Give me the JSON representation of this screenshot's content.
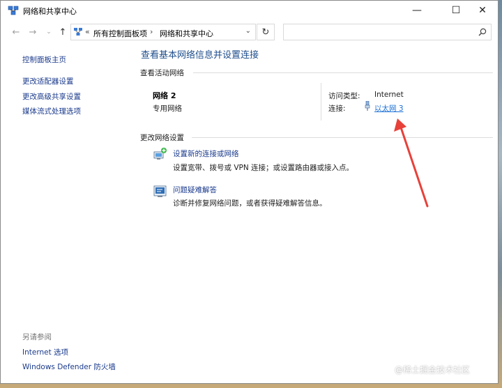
{
  "window": {
    "title": "网络和共享中心",
    "controls": {
      "minimize": "—",
      "maximize": "☐",
      "close": "✕"
    }
  },
  "navigation": {
    "back": "←",
    "forward": "→",
    "recent": "⌄",
    "up": "↑",
    "breadcrumb_prefix": "«",
    "breadcrumbs": [
      "所有控制面板项",
      "网络和共享中心"
    ],
    "breadcrumb_separator": "›",
    "dropdown": "⌄",
    "refresh": "↻",
    "search_value": ""
  },
  "sidebar": {
    "links": [
      "控制面板主页",
      "更改适配器设置",
      "更改高级共享设置",
      "媒体流式处理选项"
    ],
    "see_also_title": "另请参阅",
    "see_also_links": [
      "Internet 选项",
      "Windows Defender 防火墙"
    ]
  },
  "main": {
    "title": "查看基本网络信息并设置连接",
    "active_networks": {
      "header": "查看活动网络",
      "network_name": "网络 2",
      "network_type": "专用网络",
      "access_type_label": "访问类型:",
      "access_type_value": "Internet",
      "connections_label": "连接:",
      "connection_link": "以太网 3"
    },
    "change_settings": {
      "header": "更改网络设置",
      "tasks": [
        {
          "link": "设置新的连接或网络",
          "description": "设置宽带、拨号或 VPN 连接；或设置路由器或接入点。",
          "icon": "new-connection-icon"
        },
        {
          "link": "问题疑难解答",
          "description": "诊断并修复网络问题，或者获得疑难解答信息。",
          "icon": "troubleshoot-icon"
        }
      ]
    }
  },
  "watermark": "@稀土掘金技术社区",
  "colors": {
    "link": "#1a3a8c",
    "title": "#1e4e8c",
    "active_link": "#1a6fd6",
    "annotation_arrow": "#e8413a"
  }
}
